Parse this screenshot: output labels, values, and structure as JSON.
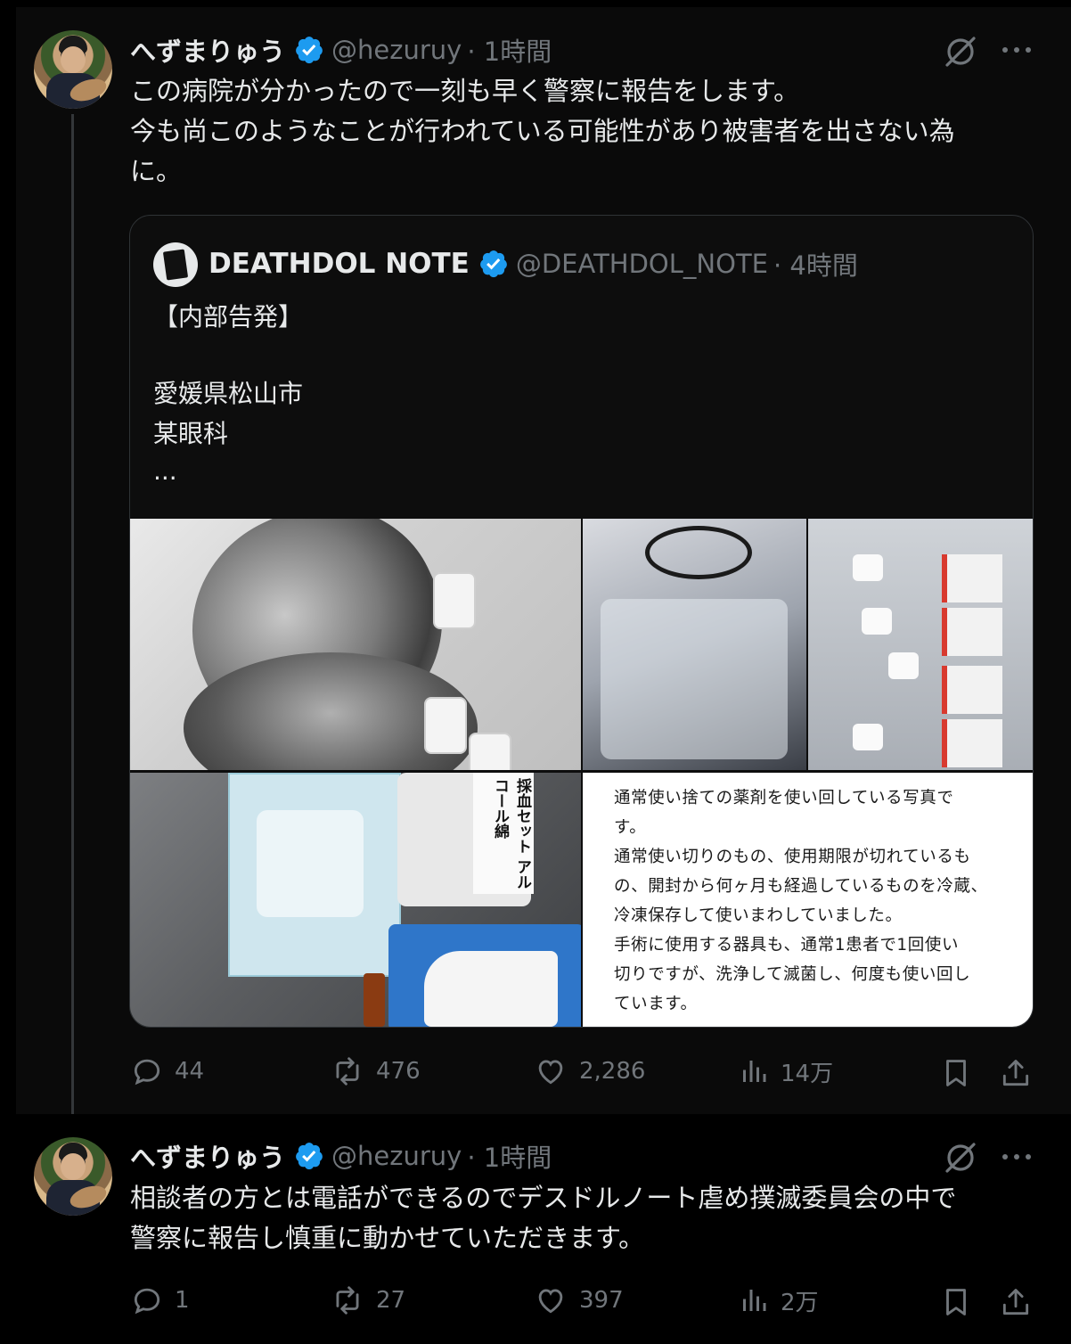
{
  "tweet1": {
    "display_name": "へずまりゅう",
    "handle": "@hezuruy",
    "time": "· 1時間",
    "lines": [
      "この病院が分かったので一刻も早く警察に報告をします。",
      "今も尚このようなことが行われている可能性があり被害者を出さない為",
      "に。"
    ],
    "quote": {
      "display_name": "DEATHDOL NOTE",
      "handle": "@DEATHDOL_NOTE",
      "time": "· 4時間",
      "lines": [
        "【内部告発】",
        "愛媛県松山市",
        "某眼科",
        "..."
      ],
      "photo_labels": {
        "alcohol_label": "採血セット アルコール綿"
      },
      "note_lines": [
        "通常使い捨ての薬剤を使い回している写真で",
        "す。",
        "通常使い切りのもの、使用期限が切れているも",
        "の、開封から何ヶ月も経過しているものを冷蔵、",
        "冷凍保存して使いまわしていました。",
        "手術に使用する器具も、通常1患者で1回使い",
        "切りですが、洗浄して滅菌し、何度も使い回し",
        "ています。"
      ]
    },
    "stats": {
      "replies": "44",
      "reposts": "476",
      "likes": "2,286",
      "views": "14万"
    }
  },
  "tweet2": {
    "display_name": "へずまりゅう",
    "handle": "@hezuruy",
    "time": "· 1時間",
    "lines": [
      "相談者の方とは電話ができるのでデスドルノート虐め撲滅委員会の中で",
      "警察に報告し慎重に動かせていただきます。"
    ],
    "stats": {
      "replies": "1",
      "reposts": "27",
      "likes": "397",
      "views": "2万"
    }
  },
  "icons": [
    "verified-badge-icon",
    "grok-icon",
    "more-icon",
    "reply-icon",
    "repost-icon",
    "like-icon",
    "views-icon",
    "bookmark-icon",
    "share-icon"
  ],
  "colors": {
    "background": "#000000",
    "text": "#e7e9ea",
    "secondary": "#71767b",
    "verified": "#1d9bf0",
    "border": "#2f3336"
  }
}
